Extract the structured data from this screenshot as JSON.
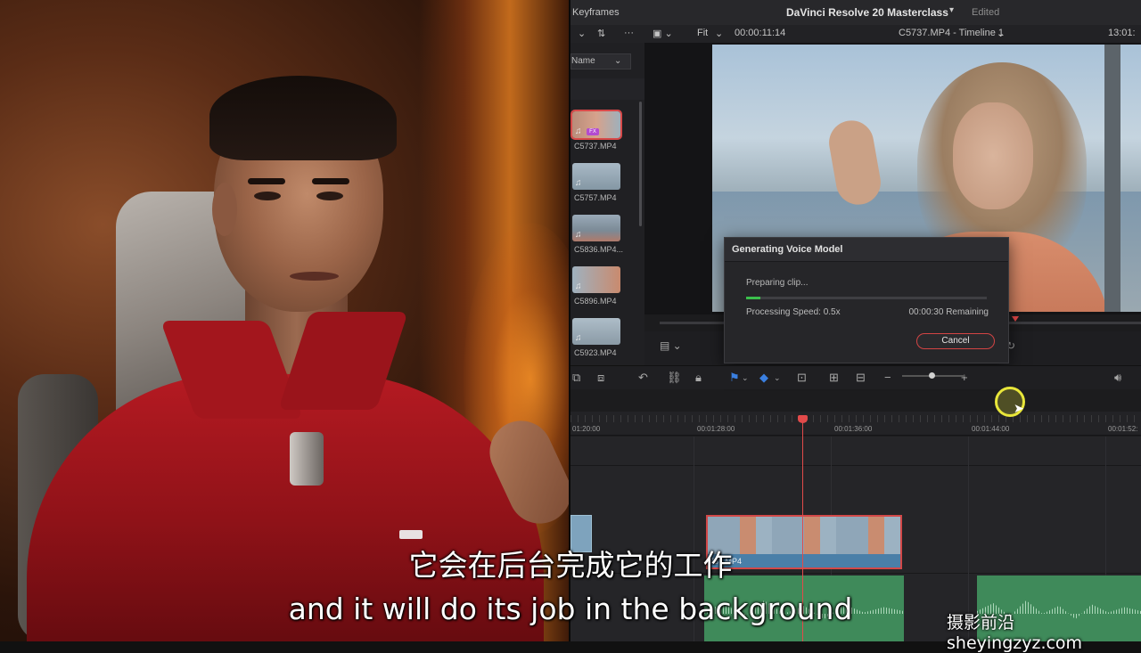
{
  "titlebar": {
    "keyframes_tab": "Keyframes",
    "project_name": "DaVinci Resolve 20 Masterclass",
    "project_state": "Edited"
  },
  "viewer_toolbar": {
    "zoom": "Fit",
    "source_timecode": "00:00:11:14",
    "clip_and_timeline": "C5737.MP4 - Timeline 1",
    "record_timecode": "13:01:"
  },
  "media_pool": {
    "sort_label": "Name",
    "clips": [
      {
        "name": "C5737.MP4",
        "selected": true
      },
      {
        "name": "C5757.MP4",
        "selected": false
      },
      {
        "name": "C5836.MP4...",
        "selected": false
      },
      {
        "name": "C5896.MP4",
        "selected": false
      },
      {
        "name": "C5923.MP4",
        "selected": false
      }
    ]
  },
  "dialog": {
    "title": "Generating Voice Model",
    "status": "Preparing clip...",
    "progress": 0.06,
    "speed": "Processing Speed: 0.5x",
    "remaining": "00:00:30 Remaining",
    "cancel_label": "Cancel"
  },
  "timeline": {
    "ruler_ticks": [
      "01:20:00",
      "00:01:28:00",
      "00:01:36:00",
      "00:01:44:00",
      "00:01:52:"
    ],
    "video_clip_label": "737.MP4"
  },
  "subtitles": {
    "chinese": "它会在后台完成它的工作",
    "english": "and it will do its job in the background"
  },
  "watermark": "摄影前沿 sheyingzyz.com",
  "colors": {
    "accent_red": "#d24848",
    "progress_green": "#3bbf4c",
    "cursor_yellow": "#e8e63a"
  }
}
